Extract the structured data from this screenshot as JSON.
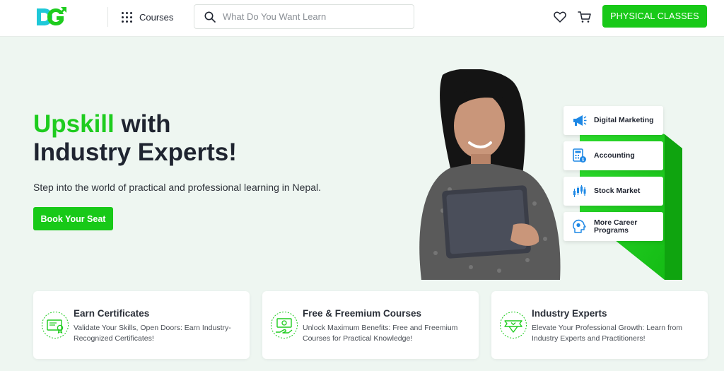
{
  "header": {
    "courses_label": "Courses",
    "search_placeholder": "What Do You Want Learn",
    "physical_classes_label": "PHYSICAL CLASSES"
  },
  "hero": {
    "title_accent": "Upskill",
    "title_rest_1": " with",
    "title_line_2": "Industry Experts!",
    "subtitle": "Step into the world of practical and professional learning in Nepal.",
    "cta_label": "Book Your Seat"
  },
  "categories": [
    {
      "label": "Digital Marketing",
      "icon": "megaphone-icon"
    },
    {
      "label": "Accounting",
      "icon": "calculator-icon"
    },
    {
      "label": "Stock Market",
      "icon": "candlestick-icon"
    },
    {
      "label_line1": "More Career",
      "label_line2": "Programs",
      "icon": "career-head-icon"
    }
  ],
  "features": [
    {
      "title": "Earn Certificates",
      "text": "Validate Your Skills, Open Doors: Earn Industry-Recognized Certificates!",
      "icon": "certificate-icon"
    },
    {
      "title": "Free & Freemium Courses",
      "text": "Unlock Maximum Benefits: Free and Freemium Courses for Practical Knowledge!",
      "icon": "money-icon"
    },
    {
      "title": "Industry Experts",
      "text": "Elevate Your Professional Growth: Learn from Industry Experts and Practitioners!",
      "icon": "expert-badge-icon"
    }
  ],
  "colors": {
    "brand_green": "#18c918",
    "accent_text": "#1ecc1e",
    "background": "#eef6f1"
  }
}
